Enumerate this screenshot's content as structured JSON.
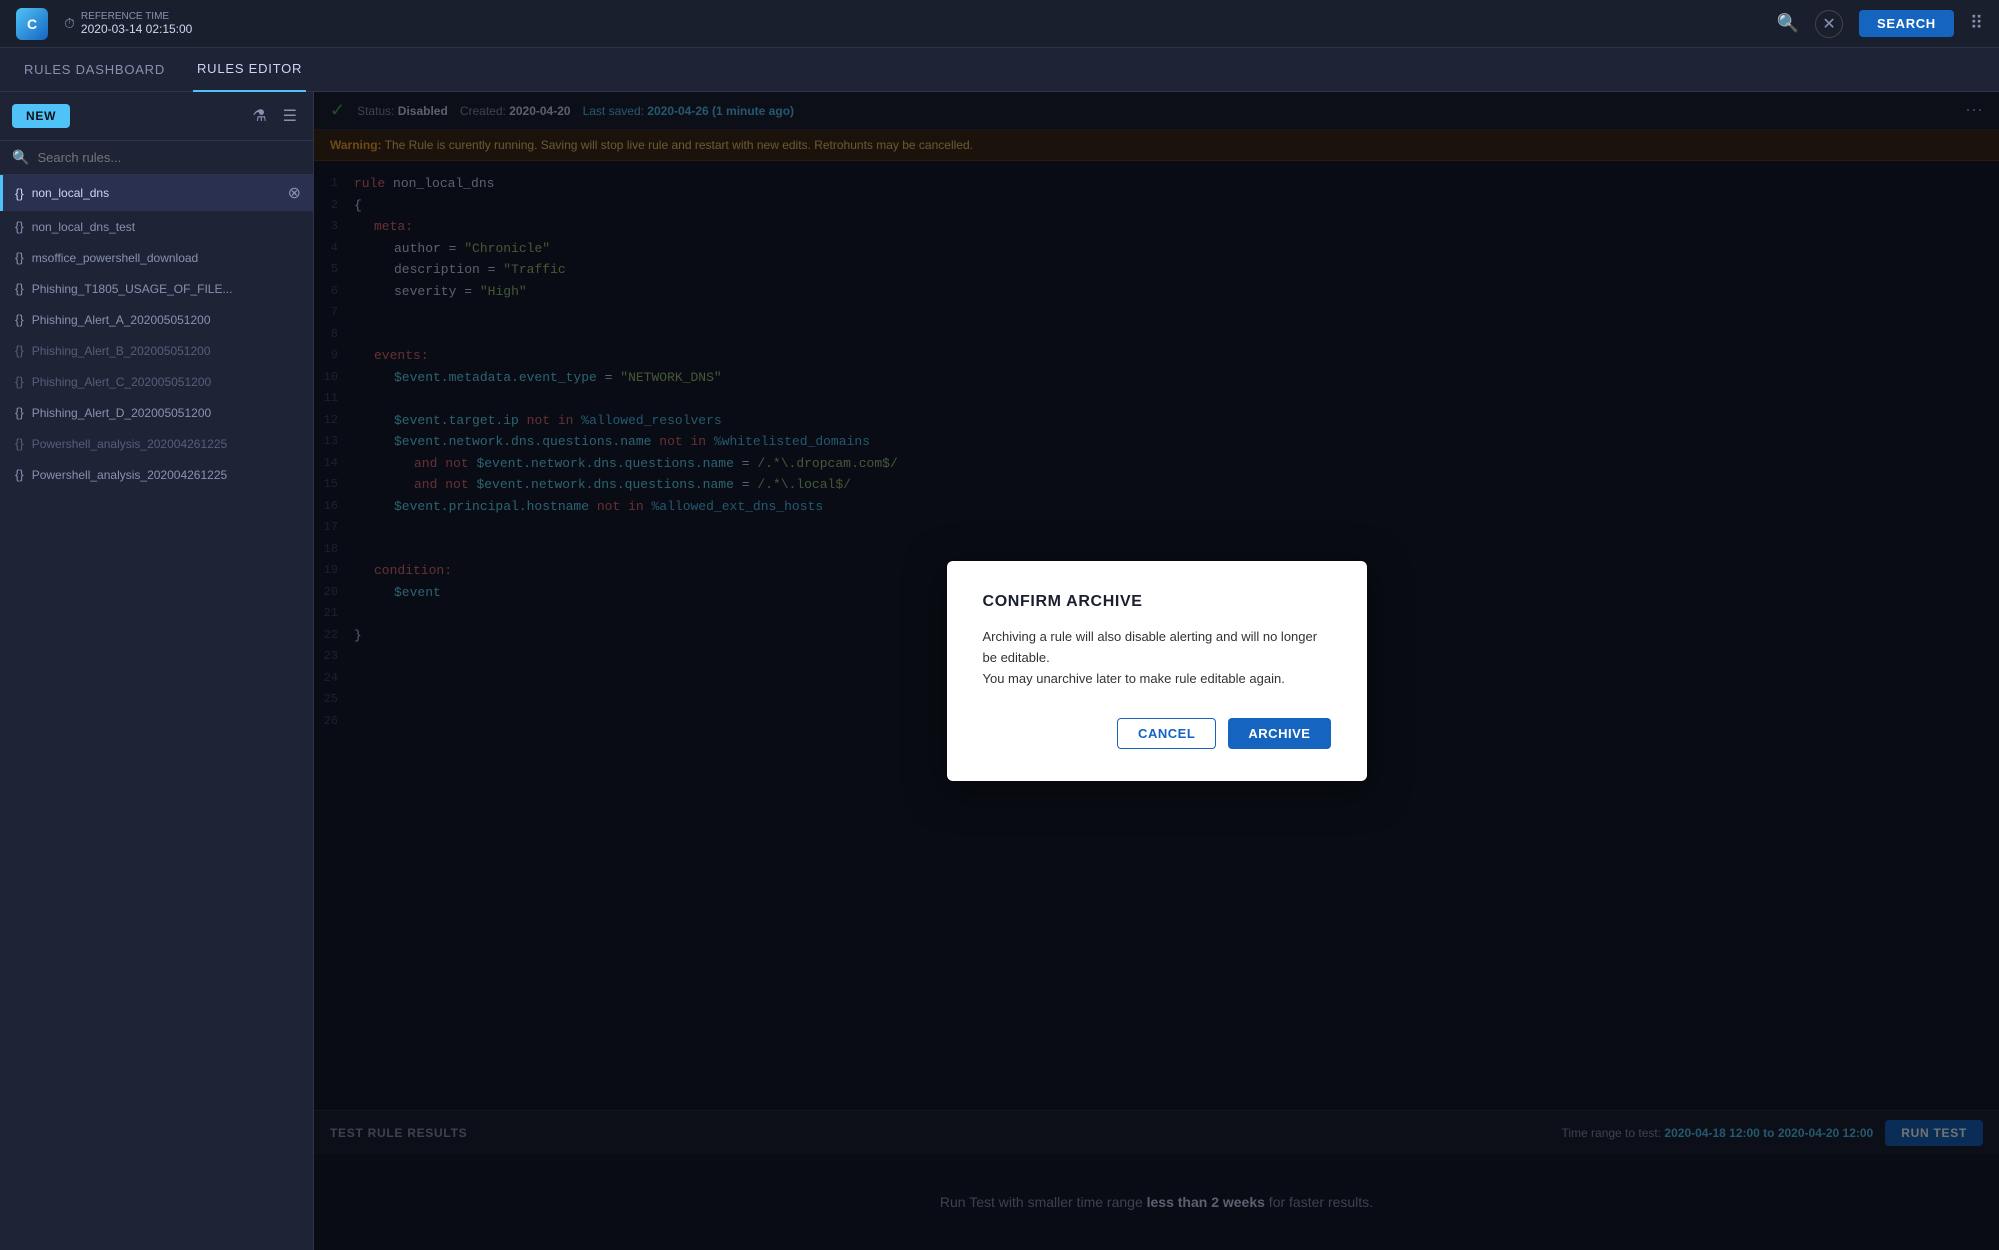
{
  "topbar": {
    "logo_text": "C",
    "reference_label": "REFERENCE TIME",
    "reference_time": "2020-03-14  02:15:00",
    "search_icon": "🔍",
    "close_icon": "✕",
    "search_btn_label": "SEARCH",
    "grid_icon": "⋮⋮"
  },
  "nav": {
    "tabs": [
      {
        "label": "RULES DASHBOARD",
        "active": false
      },
      {
        "label": "RULES EDITOR",
        "active": true
      }
    ]
  },
  "sidebar": {
    "new_btn_label": "NEW",
    "search_placeholder": "Search rules...",
    "rules": [
      {
        "name": "non_local_dns",
        "active": true,
        "muted": false,
        "icon": "{}"
      },
      {
        "name": "non_local_dns_test",
        "active": false,
        "muted": false,
        "icon": "{}"
      },
      {
        "name": "msoffice_powershell_download",
        "active": false,
        "muted": false,
        "icon": "{}"
      },
      {
        "name": "Phishing_T1805_USAGE_OF_FILE...",
        "active": false,
        "muted": false,
        "icon": "{}"
      },
      {
        "name": "Phishing_Alert_A_202005051200",
        "active": false,
        "muted": false,
        "icon": "{}"
      },
      {
        "name": "Phishing_Alert_B_202005051200",
        "active": false,
        "muted": true,
        "icon": "{}"
      },
      {
        "name": "Phishing_Alert_C_202005051200",
        "active": false,
        "muted": true,
        "icon": "{}"
      },
      {
        "name": "Phishing_Alert_D_202005051200",
        "active": false,
        "muted": false,
        "icon": "{}"
      },
      {
        "name": "Powershell_analysis_202004261225",
        "active": false,
        "muted": true,
        "icon": "{}"
      },
      {
        "name": "Powershell_analysis_202004261225",
        "active": false,
        "muted": false,
        "icon": "{}"
      }
    ]
  },
  "status_bar": {
    "check_icon": "✓",
    "status_label": "Status:",
    "status_value": "Disabled",
    "created_label": "Created:",
    "created_value": "2020-04-20",
    "saved_label": "Last saved:",
    "saved_value": "2020-04-26 (1 minute ago)",
    "dots_icon": "⋯"
  },
  "warning": {
    "label": "Warning:",
    "text": "The Rule is curently running.  Saving will stop  live rule and restart with new edits.  Retrohunts may be cancelled."
  },
  "code_lines": [
    {
      "num": 1,
      "content": "rule non_local_dns",
      "type": "rule_title"
    },
    {
      "num": 2,
      "content": "{",
      "type": "brace"
    },
    {
      "num": 3,
      "content": "    meta:",
      "type": "meta_kw"
    },
    {
      "num": 4,
      "content": "        author = \"Chronicle\"",
      "type": "assign_str"
    },
    {
      "num": 5,
      "content": "        description = \"Traffic",
      "type": "assign_str"
    },
    {
      "num": 6,
      "content": "        severity = \"High\"",
      "type": "assign_str"
    },
    {
      "num": 7,
      "content": "",
      "type": "empty"
    },
    {
      "num": 8,
      "content": "",
      "type": "empty"
    },
    {
      "num": 9,
      "content": "    events:",
      "type": "events_kw"
    },
    {
      "num": 10,
      "content": "        $event.metadata.event_type = \"NETWORK_DNS\"",
      "type": "assign_str"
    },
    {
      "num": 11,
      "content": "",
      "type": "empty"
    },
    {
      "num": 12,
      "content": "        $event.target.ip not in %allowed_resolvers",
      "type": "not_in"
    },
    {
      "num": 13,
      "content": "        $event.network.dns.questions.name not in %whitelisted_domains",
      "type": "not_in"
    },
    {
      "num": 14,
      "content": "            and not $event.network.dns.questions.name = /.*\\.dropcam.com$/",
      "type": "and_not"
    },
    {
      "num": 15,
      "content": "            and not $event.network.dns.questions.name = /.*\\.local$/",
      "type": "and_not"
    },
    {
      "num": 16,
      "content": "        $event.principal.hostname not in %allowed_ext_dns_hosts",
      "type": "not_in"
    },
    {
      "num": 17,
      "content": "",
      "type": "empty"
    },
    {
      "num": 18,
      "content": "",
      "type": "empty"
    },
    {
      "num": 19,
      "content": "    condition:",
      "type": "condition_kw"
    },
    {
      "num": 20,
      "content": "        $event",
      "type": "var"
    },
    {
      "num": 21,
      "content": "",
      "type": "empty"
    },
    {
      "num": 22,
      "content": "}",
      "type": "brace"
    },
    {
      "num": 23,
      "content": "",
      "type": "empty"
    },
    {
      "num": 24,
      "content": "",
      "type": "empty"
    },
    {
      "num": 25,
      "content": "",
      "type": "empty"
    },
    {
      "num": 26,
      "content": "",
      "type": "empty"
    }
  ],
  "test_results": {
    "label": "TEST RULE RESULTS",
    "time_range_label": "Time range to test:",
    "time_range_value": "2020-04-18 12:00 to 2020-04-20 12:00",
    "run_btn_label": "RUN TEST",
    "hint_text": "Run Test with smaller time range ",
    "hint_bold": "less than 2 weeks",
    "hint_suffix": " for faster results."
  },
  "modal": {
    "title": "CONFIRM ARCHIVE",
    "body_line1": "Archiving a rule will also disable alerting  and will no longer be editable.",
    "body_line2": "You may unarchive later to make rule editable again.",
    "cancel_label": "CANCEL",
    "archive_label": "ARCHIVE"
  }
}
